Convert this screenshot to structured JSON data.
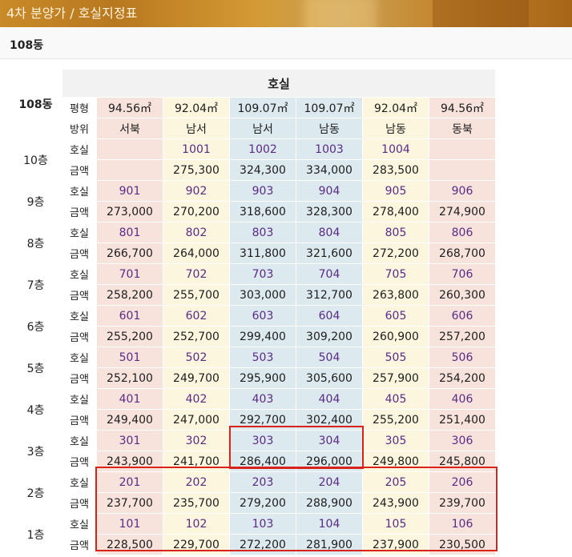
{
  "banner": {
    "title": "4차 분양가 / 호실지정표"
  },
  "subheader": {
    "title": "108동"
  },
  "table": {
    "dong_label": "108동",
    "hosil_header": "호실",
    "row_labels": {
      "size": "평형",
      "direction": "방위",
      "room": "호실",
      "price": "금액"
    },
    "sizes": [
      "94.56㎡",
      "92.04㎡",
      "109.07㎡",
      "109.07㎡",
      "92.04㎡",
      "94.56㎡"
    ],
    "directions": [
      "서북",
      "남서",
      "남서",
      "남동",
      "남동",
      "동북"
    ],
    "floors": [
      {
        "label": "10층",
        "rooms": [
          "",
          "1001",
          "1002",
          "1003",
          "1004",
          ""
        ],
        "prices": [
          "",
          "275,300",
          "324,300",
          "334,000",
          "283,500",
          ""
        ]
      },
      {
        "label": "9층",
        "rooms": [
          "901",
          "902",
          "903",
          "904",
          "905",
          "906"
        ],
        "prices": [
          "273,000",
          "270,200",
          "318,600",
          "328,300",
          "278,400",
          "274,900"
        ]
      },
      {
        "label": "8층",
        "rooms": [
          "801",
          "802",
          "803",
          "804",
          "805",
          "806"
        ],
        "prices": [
          "266,700",
          "264,000",
          "311,800",
          "321,600",
          "272,200",
          "268,700"
        ]
      },
      {
        "label": "7층",
        "rooms": [
          "701",
          "702",
          "703",
          "704",
          "705",
          "706"
        ],
        "prices": [
          "258,200",
          "255,700",
          "303,000",
          "312,700",
          "263,800",
          "260,300"
        ]
      },
      {
        "label": "6층",
        "rooms": [
          "601",
          "602",
          "603",
          "604",
          "605",
          "606"
        ],
        "prices": [
          "255,200",
          "252,700",
          "299,400",
          "309,200",
          "260,900",
          "257,200"
        ]
      },
      {
        "label": "5층",
        "rooms": [
          "501",
          "502",
          "503",
          "504",
          "505",
          "506"
        ],
        "prices": [
          "252,100",
          "249,700",
          "295,900",
          "305,600",
          "257,900",
          "254,200"
        ]
      },
      {
        "label": "4층",
        "rooms": [
          "401",
          "402",
          "403",
          "404",
          "405",
          "406"
        ],
        "prices": [
          "249,400",
          "247,000",
          "292,700",
          "302,400",
          "255,200",
          "251,400"
        ]
      },
      {
        "label": "3층",
        "rooms": [
          "301",
          "302",
          "303",
          "304",
          "305",
          "306"
        ],
        "prices": [
          "243,900",
          "241,700",
          "286,400",
          "296,000",
          "249,800",
          "245,800"
        ]
      },
      {
        "label": "2층",
        "rooms": [
          "201",
          "202",
          "203",
          "204",
          "205",
          "206"
        ],
        "prices": [
          "237,700",
          "235,700",
          "279,200",
          "288,900",
          "243,900",
          "239,700"
        ]
      },
      {
        "label": "1층",
        "rooms": [
          "101",
          "102",
          "103",
          "104",
          "105",
          "106"
        ],
        "prices": [
          "228,500",
          "229,700",
          "272,200",
          "281,900",
          "237,900",
          "230,500"
        ]
      }
    ]
  },
  "colors": {
    "pink": "#f7e3dc",
    "yellow": "#fdf6de",
    "blue": "#dce9ee",
    "highlight": "#d9231a",
    "room_text": "#5b2a86"
  }
}
